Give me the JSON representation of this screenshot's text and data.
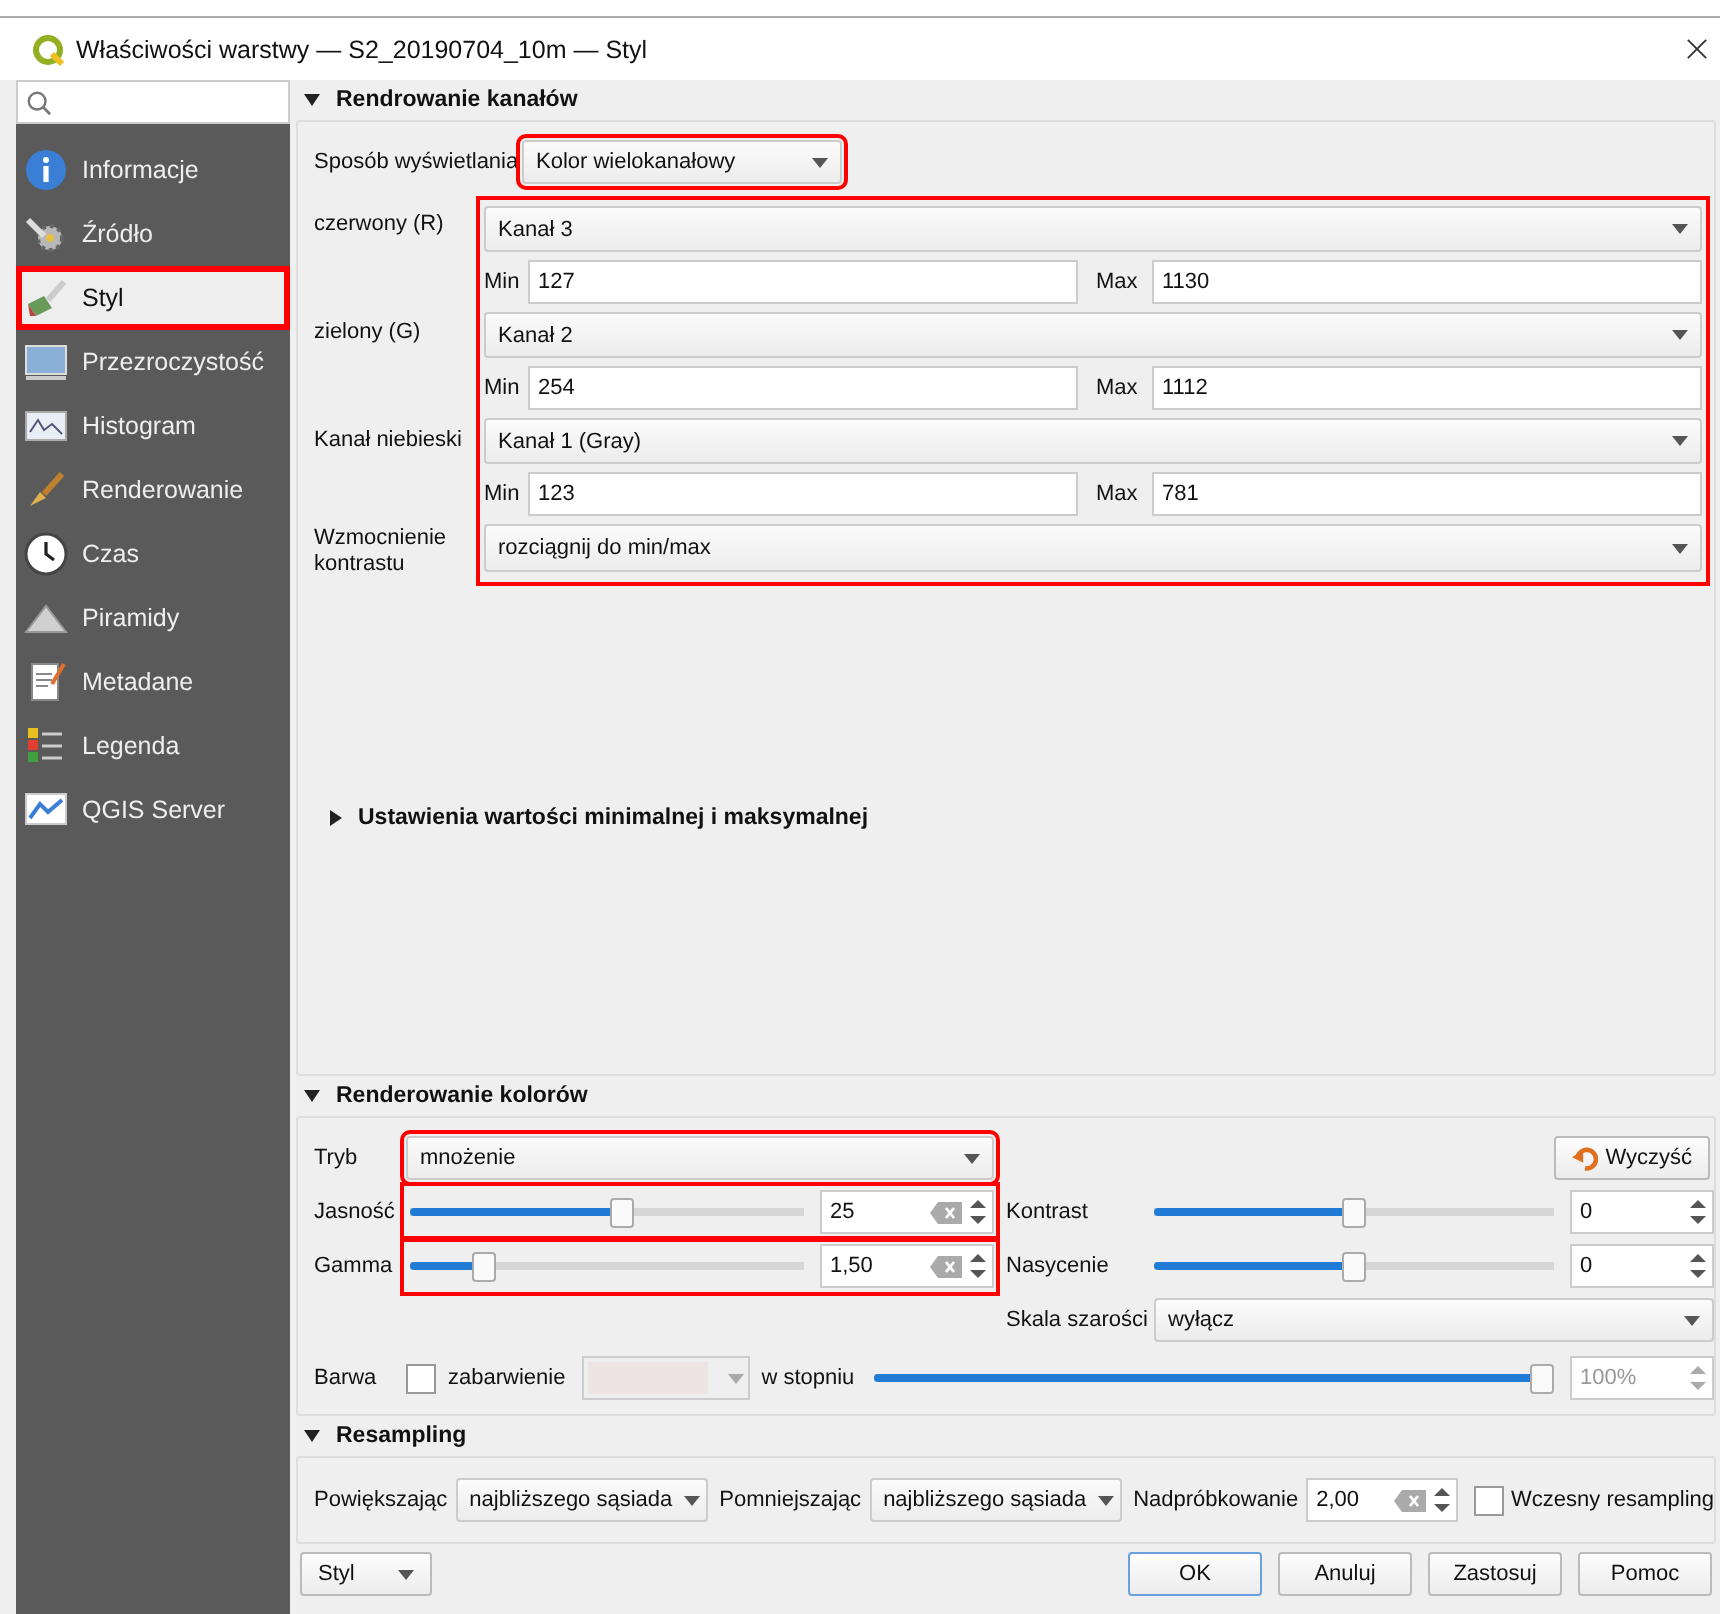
{
  "window": {
    "title": "Właściwości warstwy — S2_20190704_10m — Styl"
  },
  "sidebar": {
    "items": [
      {
        "label": "Informacje",
        "kind": "info",
        "selected": false,
        "highlighted": false
      },
      {
        "label": "Źródło",
        "kind": "source",
        "selected": false,
        "highlighted": false
      },
      {
        "label": "Styl",
        "kind": "style",
        "selected": true,
        "highlighted": true
      },
      {
        "label": "Przezroczystość",
        "kind": "transparency",
        "selected": false,
        "highlighted": false
      },
      {
        "label": "Histogram",
        "kind": "histogram",
        "selected": false,
        "highlighted": false
      },
      {
        "label": "Renderowanie",
        "kind": "rendering",
        "selected": false,
        "highlighted": false
      },
      {
        "label": "Czas",
        "kind": "time",
        "selected": false,
        "highlighted": false
      },
      {
        "label": "Piramidy",
        "kind": "pyramids",
        "selected": false,
        "highlighted": false
      },
      {
        "label": "Metadane",
        "kind": "metadata",
        "selected": false,
        "highlighted": false
      },
      {
        "label": "Legenda",
        "kind": "legend",
        "selected": false,
        "highlighted": false
      },
      {
        "label": "QGIS Server",
        "kind": "server",
        "selected": false,
        "highlighted": false
      }
    ]
  },
  "band_rendering": {
    "title": "Rendrowanie kanałów",
    "expanded": true,
    "render_type": {
      "label": "Sposób wyświetlania",
      "value": "Kolor wielokanałowy",
      "highlighted": true
    },
    "channels_highlighted": true,
    "channels": [
      {
        "label": "czerwony (R)",
        "band": "Kanał 3",
        "min_label": "Min",
        "min": "127",
        "max_label": "Max",
        "max": "1130"
      },
      {
        "label": "zielony (G)",
        "band": "Kanał 2",
        "min_label": "Min",
        "min": "254",
        "max_label": "Max",
        "max": "1112"
      },
      {
        "label": "Kanał niebieski",
        "band": "Kanał 1 (Gray)",
        "min_label": "Min",
        "min": "123",
        "max_label": "Max",
        "max": "781"
      }
    ],
    "contrast": {
      "label": "Wzmocnienie kontrastu",
      "value": "rozciągnij do min/max"
    },
    "minmax_settings": {
      "title": "Ustawienia wartości minimalnej i maksymalnej",
      "expanded": false
    }
  },
  "color_rendering": {
    "title": "Renderowanie kolorów",
    "expanded": true,
    "mode": {
      "label": "Tryb",
      "value": "mnożenie",
      "highlighted": true
    },
    "reset_button": "Wyczyść",
    "left_sliders": [
      {
        "label": "Jasność",
        "level": 0.54,
        "value": "25",
        "clearable": true,
        "highlighted": true
      },
      {
        "label": "Gamma",
        "level": 0.17,
        "value": "1,50",
        "clearable": true,
        "highlighted": true
      }
    ],
    "right_sliders": [
      {
        "label": "Kontrast",
        "level": 0.5,
        "value": "0",
        "clearable": false,
        "highlighted": false
      },
      {
        "label": "Nasycenie",
        "level": 0.5,
        "value": "0",
        "clearable": false,
        "highlighted": false
      }
    ],
    "grayscale": {
      "label": "Skala szarości",
      "value": "wyłącz"
    },
    "hue": {
      "label": "Barwa",
      "colorize_label": "zabarwienie",
      "colorize_checked": false,
      "strength_label": "w stopniu",
      "level": 1.0,
      "value": "100%",
      "disabled": true
    }
  },
  "resampling": {
    "title": "Resampling",
    "expanded": true,
    "zoomed_in": {
      "label": "Powiększając",
      "value": "najbliższego sąsiada"
    },
    "zoomed_out": {
      "label": "Pomniejszając",
      "value": "najbliższego sąsiada"
    },
    "oversampling": {
      "label": "Nadpróbkowanie",
      "value": "2,00"
    },
    "early": {
      "label": "Wczesny resampling",
      "checked": false
    }
  },
  "footer": {
    "style_menu": "Styl",
    "buttons": [
      {
        "label": "OK",
        "default": true
      },
      {
        "label": "Anuluj",
        "default": false
      },
      {
        "label": "Zastosuj",
        "default": false
      },
      {
        "label": "Pomoc",
        "default": false
      }
    ]
  }
}
